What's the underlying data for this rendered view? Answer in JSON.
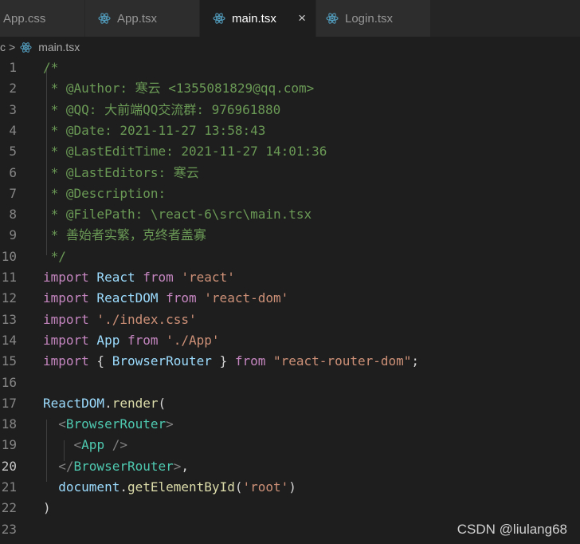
{
  "tabs": [
    {
      "label": "App.css",
      "icon": "css-file-icon",
      "active": false
    },
    {
      "label": "App.tsx",
      "icon": "react-file-icon",
      "active": false
    },
    {
      "label": "main.tsx",
      "icon": "react-file-icon",
      "active": true,
      "close": "×"
    },
    {
      "label": "Login.tsx",
      "icon": "react-file-icon",
      "active": false
    }
  ],
  "breadcrumb": {
    "prefix": "c",
    "separator": ">",
    "file": "main.tsx",
    "icon": "react-file-icon"
  },
  "editor": {
    "active_line": 20,
    "lines": [
      {
        "n": "1",
        "tokens": [
          {
            "t": "/*",
            "c": "com"
          }
        ]
      },
      {
        "n": "2",
        "tokens": [
          {
            "t": " * @Author: 寒云 <1355081829@qq.com>",
            "c": "com"
          }
        ]
      },
      {
        "n": "3",
        "tokens": [
          {
            "t": " * @QQ: 大前端QQ交流群: 976961880",
            "c": "com"
          }
        ]
      },
      {
        "n": "4",
        "tokens": [
          {
            "t": " * @Date: 2021-11-27 13:58:43",
            "c": "com"
          }
        ]
      },
      {
        "n": "5",
        "tokens": [
          {
            "t": " * @LastEditTime: 2021-11-27 14:01:36",
            "c": "com"
          }
        ]
      },
      {
        "n": "6",
        "tokens": [
          {
            "t": " * @LastEditors: 寒云",
            "c": "com"
          }
        ]
      },
      {
        "n": "7",
        "tokens": [
          {
            "t": " * @Description:",
            "c": "com"
          }
        ]
      },
      {
        "n": "8",
        "tokens": [
          {
            "t": " * @FilePath: \\react-6\\src\\main.tsx",
            "c": "com"
          }
        ]
      },
      {
        "n": "9",
        "tokens": [
          {
            "t": " * 善始者实繁，克终者盖寡",
            "c": "com"
          }
        ]
      },
      {
        "n": "10",
        "tokens": [
          {
            "t": " */",
            "c": "com"
          }
        ]
      },
      {
        "n": "11",
        "tokens": [
          {
            "t": "import",
            "c": "kw"
          },
          {
            "t": " React ",
            "c": "id"
          },
          {
            "t": "from",
            "c": "kw"
          },
          {
            "t": " 'react'",
            "c": "str"
          }
        ]
      },
      {
        "n": "12",
        "tokens": [
          {
            "t": "import",
            "c": "kw"
          },
          {
            "t": " ReactDOM ",
            "c": "id"
          },
          {
            "t": "from",
            "c": "kw"
          },
          {
            "t": " 'react-dom'",
            "c": "str"
          }
        ]
      },
      {
        "n": "13",
        "tokens": [
          {
            "t": "import",
            "c": "kw"
          },
          {
            "t": " './index.css'",
            "c": "str"
          }
        ]
      },
      {
        "n": "14",
        "tokens": [
          {
            "t": "import",
            "c": "kw"
          },
          {
            "t": " App ",
            "c": "id"
          },
          {
            "t": "from",
            "c": "kw"
          },
          {
            "t": " './App'",
            "c": "str"
          }
        ]
      },
      {
        "n": "15",
        "tokens": [
          {
            "t": "import",
            "c": "kw"
          },
          {
            "t": " { ",
            "c": "plain"
          },
          {
            "t": "BrowserRouter",
            "c": "id"
          },
          {
            "t": " } ",
            "c": "plain"
          },
          {
            "t": "from",
            "c": "kw"
          },
          {
            "t": " \"react-router-dom\"",
            "c": "str"
          },
          {
            "t": ";",
            "c": "plain"
          }
        ]
      },
      {
        "n": "16",
        "tokens": []
      },
      {
        "n": "17",
        "tokens": [
          {
            "t": "ReactDOM",
            "c": "id"
          },
          {
            "t": ".",
            "c": "plain"
          },
          {
            "t": "render",
            "c": "fn"
          },
          {
            "t": "(",
            "c": "plain"
          }
        ]
      },
      {
        "n": "18",
        "tokens": [
          {
            "t": "  ",
            "c": "plain"
          },
          {
            "t": "<",
            "c": "brk"
          },
          {
            "t": "BrowserRouter",
            "c": "tag"
          },
          {
            "t": ">",
            "c": "brk"
          }
        ]
      },
      {
        "n": "19",
        "tokens": [
          {
            "t": "    ",
            "c": "plain"
          },
          {
            "t": "<",
            "c": "brk"
          },
          {
            "t": "App",
            "c": "tag"
          },
          {
            "t": " />",
            "c": "brk"
          }
        ]
      },
      {
        "n": "20",
        "tokens": [
          {
            "t": "  ",
            "c": "plain"
          },
          {
            "t": "</",
            "c": "brk"
          },
          {
            "t": "BrowserRouter",
            "c": "tag"
          },
          {
            "t": ">",
            "c": "brk"
          },
          {
            "t": ",",
            "c": "plain"
          }
        ]
      },
      {
        "n": "21",
        "tokens": [
          {
            "t": "  ",
            "c": "plain"
          },
          {
            "t": "document",
            "c": "id"
          },
          {
            "t": ".",
            "c": "plain"
          },
          {
            "t": "getElementById",
            "c": "fn"
          },
          {
            "t": "(",
            "c": "plain"
          },
          {
            "t": "'root'",
            "c": "str"
          },
          {
            "t": ")",
            "c": "plain"
          }
        ]
      },
      {
        "n": "22",
        "tokens": [
          {
            "t": ")",
            "c": "plain"
          }
        ]
      },
      {
        "n": "23",
        "tokens": []
      }
    ]
  },
  "watermark": "CSDN @liulang68"
}
